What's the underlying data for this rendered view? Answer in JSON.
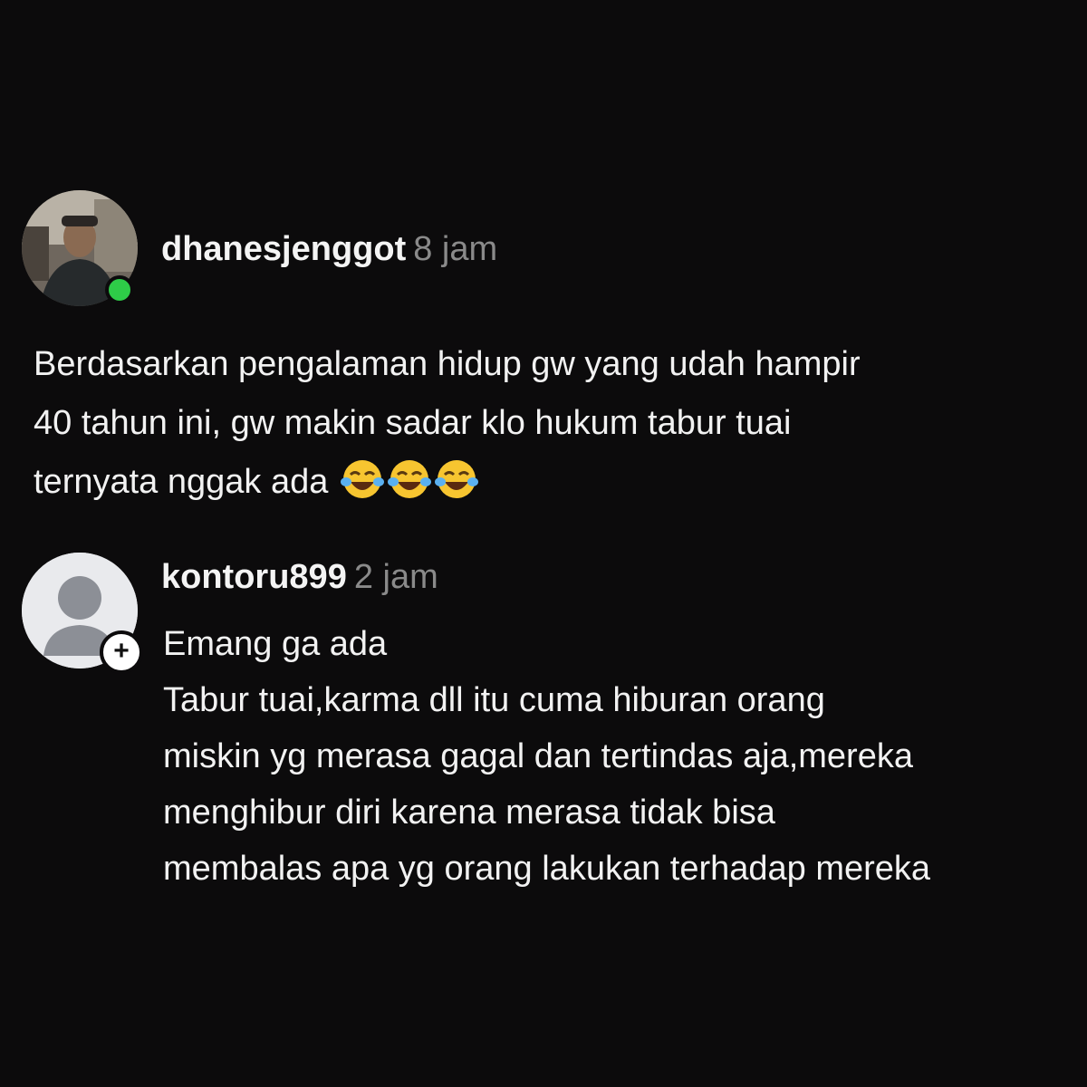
{
  "post": {
    "username": "dhanesjenggot",
    "time": "8 jam",
    "lines": [
      "Berdasarkan pengalaman hidup gw yang udah hampir",
      "40 tahun ini, gw makin sadar klo hukum tabur tuai",
      "ternyata nggak ada"
    ],
    "emojis": [
      "😂",
      "😂",
      "😂"
    ]
  },
  "reply": {
    "username": "kontoru899",
    "time": "2 jam",
    "add_icon": "+",
    "lines": [
      "Emang ga ada",
      "Tabur tuai,karma dll itu cuma hiburan orang",
      "miskin yg merasa gagal dan tertindas aja,mereka",
      "menghibur diri karena merasa tidak bisa",
      "membalas apa yg orang lakukan terhadap mereka"
    ]
  },
  "colors": {
    "background": "#0c0b0c",
    "online": "#2ecc48",
    "timestamp": "#8a8a8a"
  }
}
